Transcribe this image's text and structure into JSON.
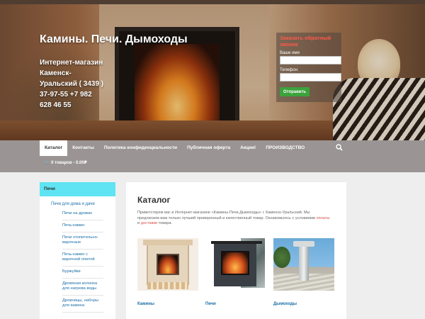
{
  "header": {
    "site_title": "Камины. Печи. Дымоходы",
    "description_lines": [
      "Интернет-магазин",
      "Каменск-",
      "Уральский ( 3439 )",
      "37-97-55 +7 982",
      "628 46 55"
    ]
  },
  "callback_form": {
    "title": "Заказать обратный звонок",
    "name_label": "Ваше имя",
    "phone_label": "Телефон",
    "submit_label": "Отправить"
  },
  "nav": {
    "items": [
      "Каталог",
      "Контакты",
      "Политика конфиденциальности",
      "Публичная оферта",
      "Акции!",
      "ПРОИЗВОДСТВО"
    ],
    "active_index": 0,
    "cart_label": "0 товаров - 0.00₽"
  },
  "sidebar": {
    "heading": "Печи",
    "category": "Печи для дома и дачи",
    "items": [
      "Печи на дровах",
      "Печь-камин",
      "Печи отопительно-варочные",
      "Печь-камин с варочной плитой",
      "Буржуйки",
      "Дровяная колонка для нагрева воды",
      "Дровницы, наборы для камина"
    ]
  },
  "main": {
    "title": "Каталог",
    "intro_start": "Приветствуем вас в Интернет-магазине «Камины.Печи.Дымоходы» г. Каменск-Уральский. Мы предлагаем вам только лучший проверенный и качественный товар. Ознакомьтесь с условиями",
    "intro_link1": "оплаты",
    "intro_mid": "и",
    "intro_link2": "доставки",
    "intro_end": "товара.",
    "products": [
      {
        "name": "Камины"
      },
      {
        "name": "Печи"
      },
      {
        "name": "Дымоходы"
      }
    ]
  },
  "colors": {
    "accent_cyan": "#5ee4f2",
    "nav_gray": "#9a9594",
    "link_blue": "#1a6fa8",
    "form_title_red": "#ff5a4a",
    "submit_green": "#3ba33b"
  }
}
